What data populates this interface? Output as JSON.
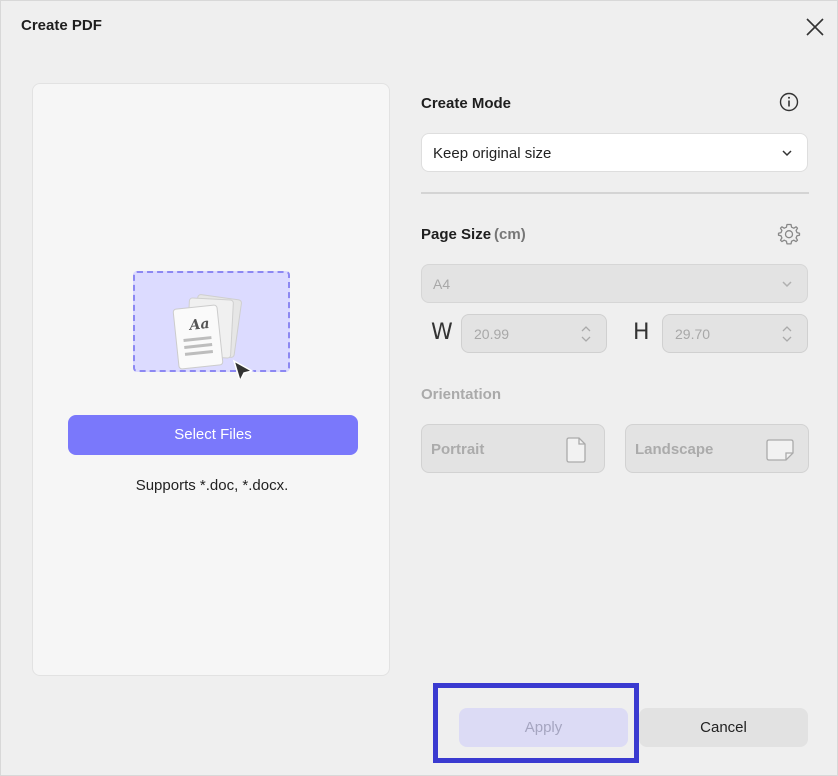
{
  "window": {
    "title": "Create PDF"
  },
  "left": {
    "select_button": "Select Files",
    "supports_text": "Supports *.doc, *.docx.",
    "illustration_text": "Aa"
  },
  "create_mode": {
    "label": "Create Mode",
    "selected": "Keep original size"
  },
  "page_size": {
    "label": "Page Size",
    "unit": "(cm)",
    "preset": "A4",
    "width_letter": "W",
    "width_value": "20.99",
    "height_letter": "H",
    "height_value": "29.70"
  },
  "orientation": {
    "label": "Orientation",
    "portrait": "Portrait",
    "landscape": "Landscape"
  },
  "footer": {
    "apply": "Apply",
    "cancel": "Cancel"
  },
  "colors": {
    "accent": "#7a78fb",
    "highlight_box": "#3a3ad0"
  }
}
